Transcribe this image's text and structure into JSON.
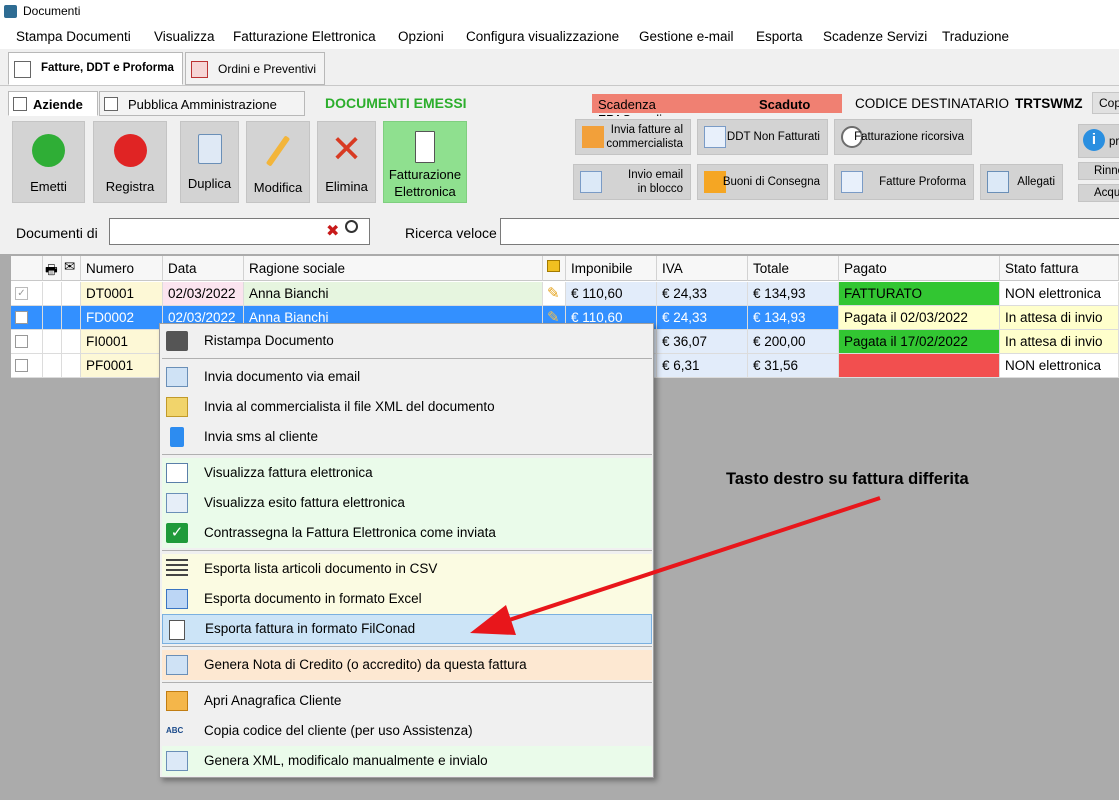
{
  "window": {
    "title": "Documenti"
  },
  "menubar": [
    "Stampa Documenti",
    "Visualizza",
    "Fatturazione Elettronica",
    "Opzioni",
    "Configura visualizzazione",
    "Gestione e-mail",
    "Esporta",
    "Scadenze Servizi",
    "Traduzione"
  ],
  "main_tabs": [
    "Fatture, DDT e Proforma",
    "Ordini e Preventivi"
  ],
  "sub_tabs": [
    "Aziende",
    "Pubblica Amministrazione"
  ],
  "header": {
    "docs_title": "DOCUMENTI EMESSI",
    "scadenza_label": "Scadenza FPASemplice",
    "scadenza_state": "Scaduto",
    "codice_label": "CODICE DESTINATARIO",
    "codice_value": "TRTSWMZ",
    "copy_label": "Cop"
  },
  "toolbar": {
    "emetti": "Emetti",
    "registra": "Registra",
    "duplica": "Duplica",
    "modifica": "Modifica",
    "elimina": "Elimina",
    "fe_line1": "Fatturazione",
    "fe_line2": "Elettronica",
    "invia_comm_1": "Invia fatture al",
    "invia_comm_2": "commercialista",
    "ddt_non_fatturati": "DDT Non Fatturati",
    "fatt_ricorsiva": "Fatturazione ricorsiva",
    "invio_email_1": "Invio email",
    "invio_email_2": "in blocco",
    "buoni_consegna": "Buoni di Consegna",
    "fatture_proforma": "Fatture Proforma",
    "allegati": "Allegati",
    "info_label": "pr",
    "rinno_label": "Rinno",
    "acqu_label": "Acqu"
  },
  "search": {
    "docs_label": "Documenti di",
    "docs_value": "",
    "quick_label": "Ricerca veloce",
    "quick_value": ""
  },
  "grid": {
    "headers": [
      "Numero",
      "Data",
      "Ragione sociale",
      "Imponibile",
      "IVA",
      "Totale",
      "Pagato",
      "Stato fattura"
    ],
    "rows": [
      {
        "numero": "DT0001",
        "data": "02/03/2022",
        "ragione": "Anna Bianchi",
        "imponibile": "€ 110,60",
        "iva": "€ 24,33",
        "totale": "€ 134,93",
        "pagato": "FATTURATO",
        "stato": "NON elettronica"
      },
      {
        "numero": "FD0002",
        "data": "02/03/2022",
        "ragione": "Anna Bianchi",
        "imponibile": "€ 110,60",
        "iva": "€ 24,33",
        "totale": "€ 134,93",
        "pagato": "Pagata il 02/03/2022",
        "stato": "In attesa di invio"
      },
      {
        "numero": "FI0001",
        "data": "",
        "ragione": "",
        "imponibile": "",
        "iva": "€ 36,07",
        "totale": "€ 200,00",
        "pagato": "Pagata il 17/02/2022",
        "stato": "In attesa di invio"
      },
      {
        "numero": "PF0001",
        "data": "",
        "ragione": "",
        "imponibile": "",
        "iva": "€ 6,31",
        "totale": "€ 31,56",
        "pagato": "",
        "stato": "NON elettronica"
      }
    ]
  },
  "context_menu": [
    "Ristampa Documento",
    "Invia documento via email",
    "Invia al commercialista il file XML del documento",
    "Invia sms al cliente",
    "Visualizza fattura elettronica",
    "Visualizza esito fattura elettronica",
    "Contrassegna la Fattura Elettronica come inviata",
    "Esporta lista articoli documento in CSV",
    "Esporta documento in formato Excel",
    "Esporta fattura in formato FilConad",
    "Genera Nota di Credito (o accredito) da questa fattura",
    "Apri Anagrafica Cliente",
    "Copia codice del cliente (per uso Assistenza)",
    "Genera XML, modificalo manualmente e invialo"
  ],
  "annotation": "Tasto destro su fattura differita",
  "colors": {
    "accent_green": "#2cae2c",
    "selected_row": "#3390ff",
    "paid_green": "#32c632",
    "unpaid_red": "#f24f4f",
    "scadenza_red": "#f08072"
  }
}
